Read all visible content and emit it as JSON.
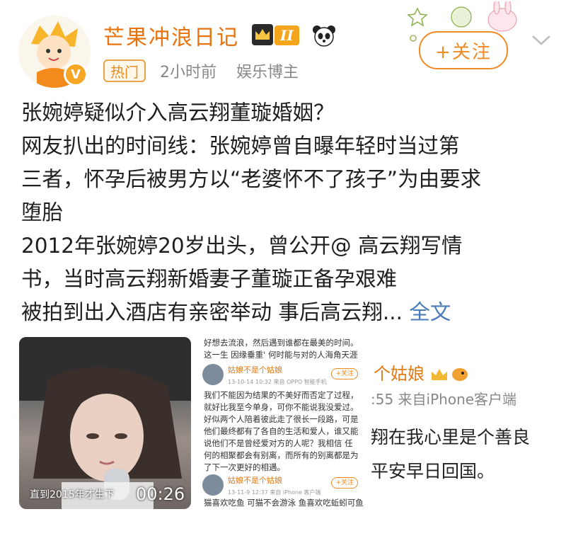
{
  "header": {
    "username": "芒果冲浪日记",
    "level_badge": "II",
    "hot_tag": "热门",
    "time_ago": "2小时前",
    "category": "娱乐博主",
    "follow_label": "+关注",
    "brand_color": "#e8720c"
  },
  "post": {
    "lines": [
      "张婉婷疑似介入高云翔董璇婚姻？",
      "网友扒出的时间线：张婉婷曾自曝年轻时当过第",
      "三者，怀孕后被男方以“老婆怀不了孩子”为由要求",
      "堕胎",
      "2012年张婉婷20岁出头，曾公开@ 高云翔写情",
      "书，当时高云翔新婚妻子董璇正备孕艰难",
      "被拍到出入酒店有亲密举动 事后高云翔..."
    ],
    "more_label": "全文",
    "link_color": "#4a7ab8"
  },
  "media": {
    "video": {
      "subtitle": "直到2015年才生下",
      "duration": "00:26"
    },
    "screenshot": {
      "top_lines": [
        "好想去流浪，然后遇到谁都在最美的时间。",
        "这一生 因缘垂重' 何时能与对的人海角天涯"
      ],
      "comment1": {
        "user": "姑娘不是个姑娘",
        "meta": "13-10-14 10:32  来自 OPPO 智能手机",
        "follow": "+关注",
        "lines": [
          "我们不能因为结果的不美好而否定了过程，",
          "就好比我至今单身，可你不能说我没爱过。",
          "好似两个人陪着彼此走了很长一段路，可是",
          "他们最终都有了各自的生活和爱人，谁又能",
          "说他们不是曾经爱对方的人呢？我相信 任",
          "何的相聚都会有别离，而所有的别离都是为",
          "了下一次更好的相遇。"
        ]
      },
      "comment2": {
        "user": "姑娘不是个姑娘",
        "meta": "13-11-9 12:37  来自 iPhone 客户端",
        "follow": "+关注",
        "lines": [
          "猫喜欢吃鱼 可猫不会游泳 鱼喜欢吃蚯蚓可鱼"
        ]
      }
    },
    "crop": {
      "name": "个姑娘",
      "meta": ":55  来自iPhone客户端",
      "line1": "翔在我心里是个善良",
      "line2": "平安早日回国。"
    }
  }
}
